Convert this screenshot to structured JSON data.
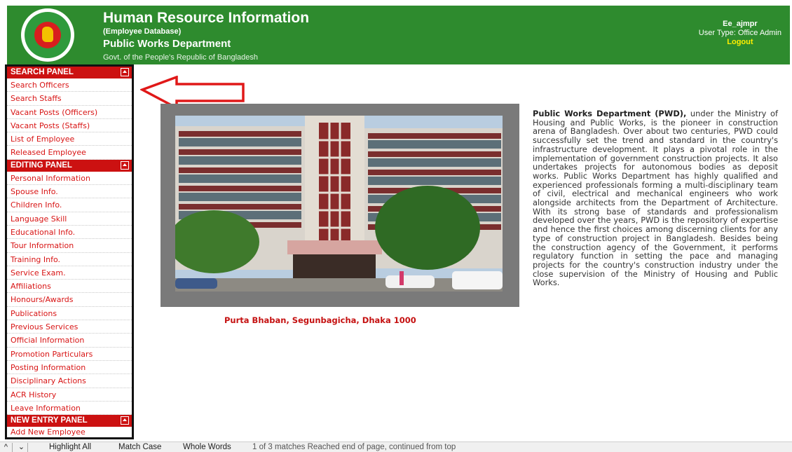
{
  "header": {
    "title": "Human Resource Information",
    "subtitle": "(Employee Database)",
    "department": "Public Works Department",
    "government": "Govt. of the People's Republic of Bangladesh",
    "username": "Ee_ajmpr",
    "user_type": "User Type: Office Admin",
    "logout_label": "Logout",
    "logo_icon": "bangladesh-government-seal"
  },
  "sidebar": {
    "search_panel": {
      "title": "SEARCH PANEL",
      "items": [
        "Search Officers",
        "Search Staffs",
        "Vacant Posts (Officers)",
        "Vacant Posts (Staffs)",
        "List of Employee",
        "Released Employee"
      ]
    },
    "editing_panel": {
      "title": "EDITING PANEL",
      "items": [
        "Personal Information",
        "Spouse Info.",
        "Children Info.",
        "Language Skill",
        "Educational Info.",
        "Tour Information",
        "Training Info.",
        "Service Exam.",
        "Affiliations",
        "Honours/Awards",
        "Publications",
        "Previous Services",
        "Official Information",
        "Promotion Particulars",
        "Posting Information",
        "Disciplinary Actions",
        "ACR History",
        "Leave Information"
      ]
    },
    "new_entry_panel": {
      "title": "NEW ENTRY PANEL",
      "items": [
        "Add New Employee"
      ]
    }
  },
  "main": {
    "caption": "Purta Bhaban, Segunbagicha, Dhaka 1000",
    "description_lead": "Public Works Department (PWD),",
    "description_body": " under the Ministry of Housing and Public Works, is the pioneer in construction arena of Bangladesh. Over about two centuries, PWD could successfully set the trend and standard in the country's infrastructure development. It plays a pivotal role in the implementation of government construction projects. It also undertakes projects for autonomous bodies as deposit works. Public Works Department has highly qualified and experienced professionals forming a multi-disciplinary team of civil, electrical and mechanical engineers who work alongside architects from the Department of Architecture. With its strong base of standards and professionalism developed over the years, PWD is the repository of expertise and hence the first choices among discerning clients for any type of construction project in Bangladesh. Besides being the construction agency of the Government, it performs regulatory function in setting the pace and managing projects for the country's construction industry under the close supervision of the Ministry of Housing and Public Works."
  },
  "findbar": {
    "prev_icon": "chevron-up-icon",
    "next_icon": "chevron-down-icon",
    "highlight_all": "Highlight All",
    "match_case": "Match Case",
    "whole_words": "Whole Words",
    "status": "1 of 3 matches   Reached end of page, continued from top"
  },
  "colors": {
    "header_green": "#2e8b2e",
    "panel_red": "#cc1111",
    "link_red": "#d81414",
    "logout_yellow": "#ffee00"
  }
}
